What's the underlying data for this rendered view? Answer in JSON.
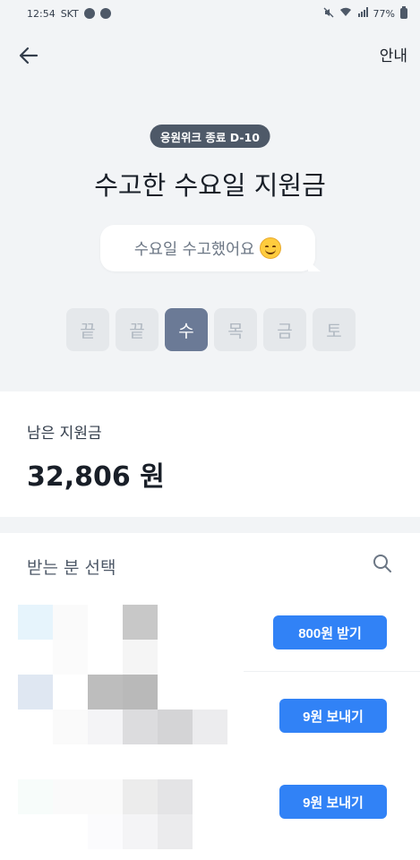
{
  "status_bar": {
    "time": "12:54",
    "carrier": "SKT",
    "battery": "77%"
  },
  "header": {
    "guide_label": "안내"
  },
  "hero": {
    "badge": "응원위크 종료 D-10",
    "title": "수고한 수요일 지원금",
    "bubble_text": "수요일 수고했어요",
    "days": [
      {
        "label": "끝",
        "active": false
      },
      {
        "label": "끝",
        "active": false
      },
      {
        "label": "수",
        "active": true
      },
      {
        "label": "목",
        "active": false
      },
      {
        "label": "금",
        "active": false
      },
      {
        "label": "토",
        "active": false
      }
    ]
  },
  "balance": {
    "label": "남은 지원금",
    "value": "32,806 원"
  },
  "recipients": {
    "title": "받는 분 선택",
    "items": [
      {
        "action_label": "800원 받기"
      },
      {
        "action_label": "9원 보내기"
      },
      {
        "action_label": "9원 보내기"
      }
    ]
  },
  "colors": {
    "accent": "#3182f6",
    "background": "#f2f4f6",
    "active_day": "#6b7a96",
    "badge": "#4e5968"
  },
  "icons": {
    "back": "arrow-left-icon",
    "search": "search-icon",
    "emoji": "smiling-face-icon"
  }
}
